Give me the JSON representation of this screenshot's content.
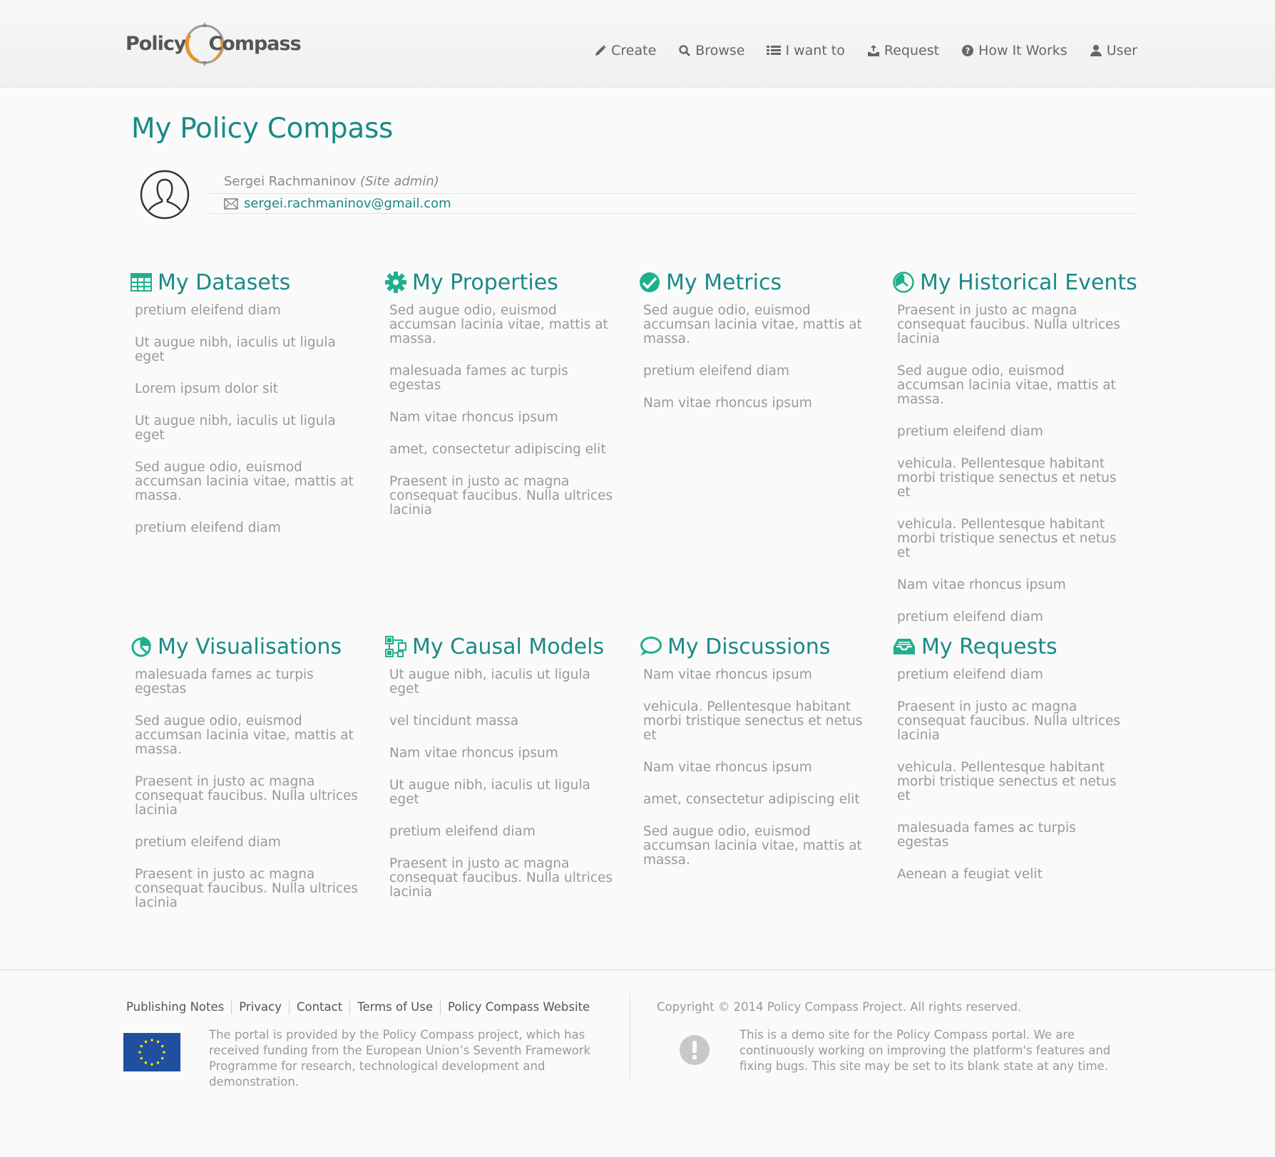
{
  "brand": {
    "word1": "Policy",
    "word2": "Compass"
  },
  "nav": [
    {
      "label": "Create",
      "icon": "pencil-icon"
    },
    {
      "label": "Browse",
      "icon": "search-icon"
    },
    {
      "label": "I want to",
      "icon": "list-icon"
    },
    {
      "label": "Request",
      "icon": "inbox-icon"
    },
    {
      "label": "How It Works",
      "icon": "question-circle-icon"
    },
    {
      "label": "User",
      "icon": "user-icon"
    }
  ],
  "page": {
    "title": "My Policy Compass"
  },
  "profile": {
    "name": "Sergei Rachmaninov",
    "role": "(Site admin)",
    "email": "sergei.rachmaninov@gmail.com"
  },
  "sections": [
    {
      "title": "My Datasets",
      "icon": "table-icon",
      "items": [
        "pretium eleifend diam",
        "Ut augue nibh, iaculis ut ligula eget",
        "Lorem ipsum dolor sit",
        "Ut augue nibh, iaculis ut ligula eget",
        "Sed augue odio, euismod accumsan lacinia vitae, mattis at massa.",
        "pretium eleifend diam"
      ]
    },
    {
      "title": "My Properties",
      "icon": "gear-icon",
      "items": [
        "Sed augue odio, euismod accumsan lacinia vitae, mattis at massa.",
        "malesuada fames ac turpis egestas",
        "Nam vitae rhoncus ipsum",
        "amet, consectetur adipiscing elit",
        "Praesent in justo ac magna consequat faucibus. Nulla ultrices lacinia"
      ]
    },
    {
      "title": "My Metrics",
      "icon": "check-circle-icon",
      "items": [
        "Sed augue odio, euismod accumsan lacinia vitae, mattis at massa.",
        "pretium eleifend diam",
        "Nam vitae rhoncus ipsum"
      ]
    },
    {
      "title": "My Historical Events",
      "icon": "clock-icon",
      "items": [
        "Praesent in justo ac magna consequat faucibus. Nulla ultrices lacinia",
        "Sed augue odio, euismod accumsan lacinia vitae, mattis at massa.",
        "pretium eleifend diam",
        "vehicula. Pellentesque habitant morbi tristique senectus et netus et",
        "vehicula. Pellentesque habitant morbi tristique senectus et netus et",
        "Nam vitae rhoncus ipsum",
        "pretium eleifend diam"
      ]
    },
    {
      "title": "My Visualisations",
      "icon": "pie-chart-icon",
      "items": [
        "malesuada fames ac turpis egestas",
        "Sed augue odio, euismod accumsan lacinia vitae, mattis at massa.",
        "Praesent in justo ac magna consequat faucibus. Nulla ultrices lacinia",
        "pretium eleifend diam",
        "Praesent in justo ac magna consequat faucibus. Nulla ultrices lacinia"
      ]
    },
    {
      "title": "My Causal Models",
      "icon": "network-icon",
      "items": [
        "Ut augue nibh, iaculis ut ligula eget",
        "vel tincidunt massa",
        "Nam vitae rhoncus ipsum",
        "Ut augue nibh, iaculis ut ligula eget",
        "pretium eleifend diam",
        "Praesent in justo ac magna consequat faucibus. Nulla ultrices lacinia"
      ]
    },
    {
      "title": "My Discussions",
      "icon": "speech-bubble-icon",
      "items": [
        "Nam vitae rhoncus ipsum",
        "vehicula. Pellentesque habitant morbi tristique senectus et netus et",
        "Nam vitae rhoncus ipsum",
        "amet, consectetur adipiscing elit",
        "Sed augue odio, euismod accumsan lacinia vitae, mattis at massa."
      ]
    },
    {
      "title": "My Requests",
      "icon": "inbox-tray-icon",
      "items": [
        "pretium eleifend diam",
        "Praesent in justo ac magna consequat faucibus. Nulla ultrices lacinia",
        "vehicula. Pellentesque habitant morbi tristique senectus et netus et",
        "malesuada fames ac turpis egestas",
        "Aenean a feugiat velit"
      ]
    }
  ],
  "footer": {
    "links": [
      "Publishing Notes",
      "Privacy",
      "Contact",
      "Terms of Use",
      "Policy Compass Website"
    ],
    "funding": "The portal is provided by the Policy Compass project, which has received funding from the European Union’s Seventh Framework Programme for research, technological development and demonstration.",
    "copyright": "Copyright © 2014 Policy Compass Project. All rights reserved.",
    "demo_note": "This is a demo site for the Policy Compass portal. We are continuously working on improving the platform's features and fixing bugs. This site may be set to its blank state at any time."
  },
  "colors": {
    "accent": "#1a8a86",
    "icon_green": "#1fb08e",
    "logo_orange": "#e8942a",
    "eu_blue": "#1f4f9e",
    "eu_star": "#ffdd00"
  }
}
